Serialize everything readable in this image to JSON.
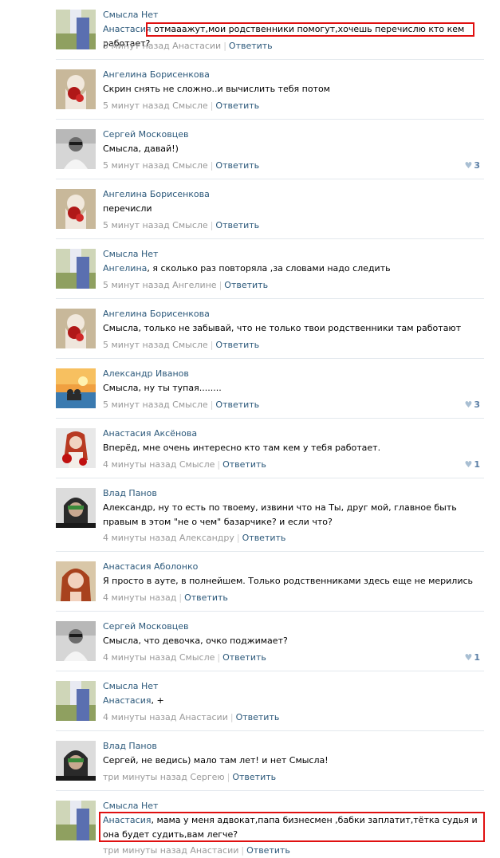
{
  "comments": [
    {
      "author": "Смысла Нет",
      "mention": "Анастасия",
      "text": "отмааажут,мои родственники помогут,хочешь перечислю кто кем работает?",
      "time": "5 минут назад Анастасии",
      "reply": "Ответить",
      "likes": "",
      "avatar": "smysla-net"
    },
    {
      "author": "Ангелина Борисенкова",
      "mention": "",
      "text": "Скрин снять не сложно..и вычислить тебя потом",
      "time": "5 минут назад Смысле",
      "reply": "Ответить",
      "likes": "",
      "avatar": "angelina"
    },
    {
      "author": "Сергей Московцев",
      "mention": "",
      "text": "Смысла, давай!)",
      "time": "5 минут назад Смысле",
      "reply": "Ответить",
      "likes": "3",
      "avatar": "sergey"
    },
    {
      "author": "Ангелина Борисенкова",
      "mention": "",
      "text": "перечисли",
      "time": "5 минут назад Смысле",
      "reply": "Ответить",
      "likes": "",
      "avatar": "angelina"
    },
    {
      "author": "Смысла Нет",
      "mention": "Ангелина",
      "text": ", я сколько раз повторяла ,за словами надо следить",
      "time": "5 минут назад Ангелине",
      "reply": "Ответить",
      "likes": "",
      "avatar": "smysla-net"
    },
    {
      "author": "Ангелина Борисенкова",
      "mention": "",
      "text": "Смысла, только не забывай, что не только твои родственники там работают",
      "time": "5 минут назад Смысле",
      "reply": "Ответить",
      "likes": "",
      "avatar": "angelina"
    },
    {
      "author": "Александр Иванов",
      "mention": "",
      "text": "Смысла, ну ты тупая........",
      "time": "5 минут назад Смысле",
      "reply": "Ответить",
      "likes": "3",
      "avatar": "alexander"
    },
    {
      "author": "Анастасия Аксёнова",
      "mention": "",
      "text": "Вперёд, мне очень интересно кто там кем у тебя работает.",
      "time": "4 минуты назад Смысле",
      "reply": "Ответить",
      "likes": "1",
      "avatar": "anastasia-a"
    },
    {
      "author": "Влад Панов",
      "mention": "",
      "text": "Александр, ну то есть по твоему, извини что на Ты, друг мой, главное быть правым в этом \"не о чем\" базарчике? и если что?",
      "time": "4 минуты назад Александру",
      "reply": "Ответить",
      "likes": "",
      "avatar": "vlad"
    },
    {
      "author": "Анастасия Аболонко",
      "mention": "",
      "text": "Я просто в ауте, в полнейшем. Только родственниками здесь еще не мерились",
      "time": "4 минуты назад",
      "reply": "Ответить",
      "likes": "",
      "avatar": "anastasia-ab"
    },
    {
      "author": "Сергей Московцев",
      "mention": "",
      "text": "Смысла, что девочка, очко поджимает?",
      "time": "4 минуты назад Смысле",
      "reply": "Ответить",
      "likes": "1",
      "avatar": "sergey"
    },
    {
      "author": "Смысла Нет",
      "mention": "Анастасия",
      "text": ", +",
      "time": "4 минуты назад Анастасии",
      "reply": "Ответить",
      "likes": "",
      "avatar": "smysla-net"
    },
    {
      "author": "Влад Панов",
      "mention": "",
      "text": "Сергей, не ведись) мало там лет! и нет Смысла!",
      "time": "три минуты назад Сергею",
      "reply": "Ответить",
      "likes": "",
      "avatar": "vlad"
    },
    {
      "author": "Смысла Нет",
      "mention": "Анастасия",
      "text": ", мама у меня адвокат,папа бизнесмен ,бабки заплатит,тётка судья и она будет судить,вам легче?",
      "time": "три минуты назад Анастасии",
      "reply": "Ответить",
      "likes": "",
      "avatar": "smysla-net"
    }
  ]
}
